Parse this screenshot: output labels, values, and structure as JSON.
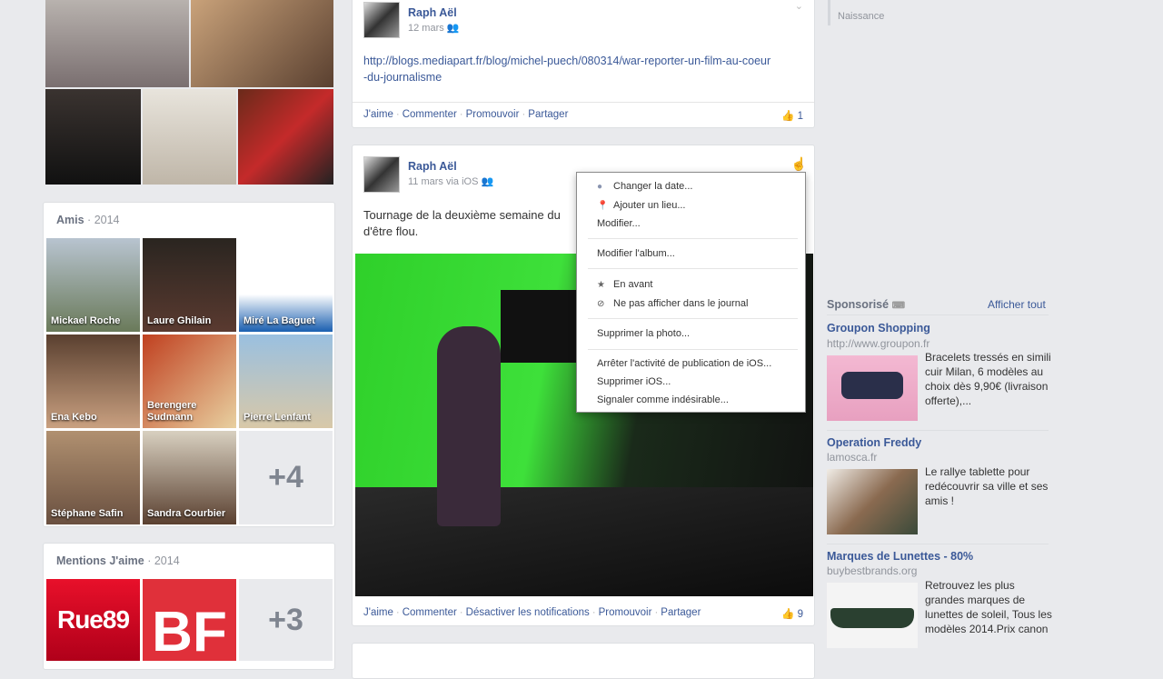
{
  "timeline_marker": "Naissance",
  "friends": {
    "title": "Amis",
    "year": "2014",
    "more": "+4",
    "items": [
      "Mickael Roche",
      "Laure Ghilain",
      "Miré La Baguet",
      "Ena Kebo",
      "Berengere Sudmann",
      "Pierre Lenfant",
      "Stéphane Safin",
      "Sandra Courbier"
    ]
  },
  "likes_box": {
    "title": "Mentions J'aime",
    "year": "2014",
    "more": "+3",
    "pages": [
      "Rue89",
      "BF"
    ]
  },
  "posts": [
    {
      "author": "Raph Aël",
      "date": "12 mars",
      "link": "http://blogs.mediapart.fr/blog/michel-puech/080314/war-reporter-un-film-au-coeur-du-journalisme",
      "actions": [
        "J'aime",
        "Commenter",
        "Promouvoir",
        "Partager"
      ],
      "likes": "1"
    },
    {
      "author": "Raph Aël",
      "date": "11 mars via iOS",
      "text": "Tournage de la deuxième semaine du",
      "text2": "d'être flou.",
      "actions": [
        "J'aime",
        "Commenter",
        "Désactiver les notifications",
        "Promouvoir",
        "Partager"
      ],
      "likes": "9"
    }
  ],
  "menu": {
    "items": [
      "Changer la date...",
      "Ajouter un lieu...",
      "Modifier...",
      "Modifier l'album...",
      "En avant",
      "Ne pas afficher dans le journal",
      "Supprimer la photo...",
      "Arrêter l'activité de publication de iOS...",
      "Supprimer iOS...",
      "Signaler comme indésirable..."
    ]
  },
  "sponsored": {
    "title": "Sponsorisé",
    "see_all": "Afficher tout",
    "ads": [
      {
        "title": "Groupon Shopping",
        "url": "http://www.groupon.fr",
        "text": "Bracelets tressés en simili cuir Milan, 6 modèles au choix dès 9,90€ (livraison offerte),..."
      },
      {
        "title": "Operation Freddy",
        "url": "lamosca.fr",
        "text": "Le rallye tablette pour redécouvrir sa ville et ses amis !"
      },
      {
        "title": "Marques de Lunettes - 80%",
        "url": "buybestbrands.org",
        "text": "Retrouvez les plus grandes marques de lunettes de soleil, Tous les modèles 2014.Prix canon"
      }
    ]
  }
}
